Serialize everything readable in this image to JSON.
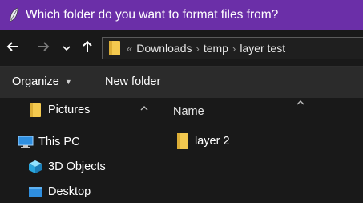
{
  "titlebar": {
    "title": "Which folder do you want to format files from?",
    "icon": "feather-icon",
    "bg_color": "#6b2fa8"
  },
  "nav": {
    "back_icon": "back-arrow-icon",
    "forward_icon": "forward-arrow-icon",
    "recent_icon": "chevron-down-icon",
    "up_icon": "up-arrow-icon"
  },
  "address": {
    "overflow_glyph": "«",
    "crumbs": [
      "Downloads",
      "temp",
      "layer test"
    ],
    "separator": "›"
  },
  "toolbar": {
    "organize_label": "Organize",
    "organize_caret": "▼",
    "new_folder_label": "New folder"
  },
  "sidebar": {
    "items": [
      {
        "label": "Pictures",
        "icon": "folder-icon"
      },
      {
        "label": "This PC",
        "icon": "computer-icon"
      },
      {
        "label": "3D Objects",
        "icon": "cube-icon"
      },
      {
        "label": "Desktop",
        "icon": "desktop-icon"
      }
    ]
  },
  "content": {
    "column_name": "Name",
    "files": [
      {
        "name": "layer 2",
        "icon": "folder-icon"
      }
    ]
  },
  "colors": {
    "folder": "#f3c94f",
    "background": "#191919",
    "toolbar": "#2b2b2b"
  }
}
